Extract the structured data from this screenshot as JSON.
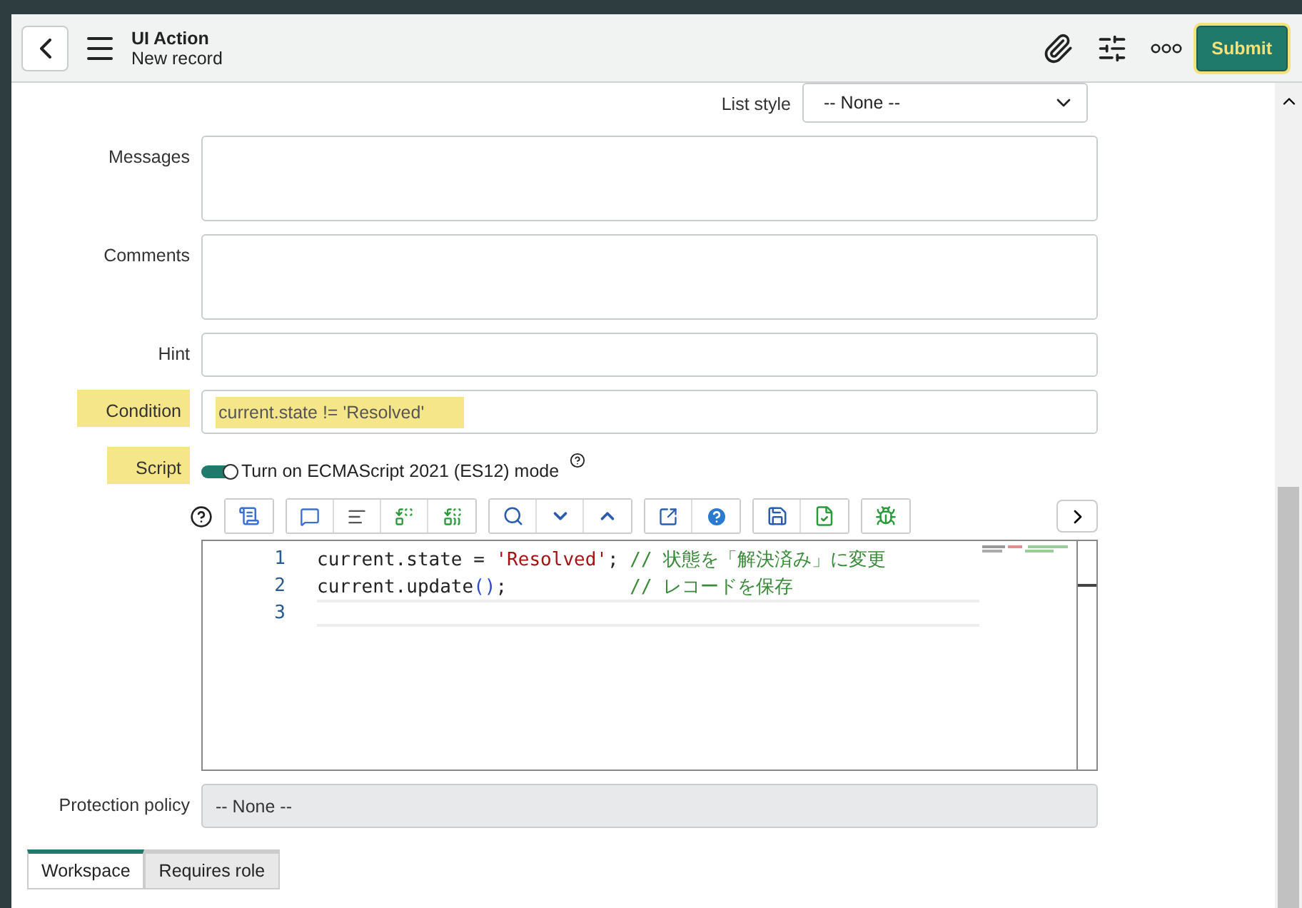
{
  "header": {
    "title": "UI Action",
    "subtitle": "New record",
    "submit": {
      "label": "Submit",
      "highlighted": true
    }
  },
  "list_style": {
    "label": "List style",
    "value": "-- None --"
  },
  "messages": {
    "label": "Messages"
  },
  "comments": {
    "label": "Comments"
  },
  "hint": {
    "label": "Hint"
  },
  "condition": {
    "label": "Condition",
    "value": "current.state != 'Resolved'",
    "highlighted": true
  },
  "script": {
    "label": "Script",
    "highlighted": true,
    "toggle": {
      "label": "Turn on ECMAScript 2021 (ES12) mode",
      "on": true
    },
    "lines": [
      {
        "number": "1",
        "tokens": [
          {
            "kind": "plain",
            "text": "current.state = "
          },
          {
            "kind": "string",
            "text": "'Resolved'"
          },
          {
            "kind": "plain",
            "text": "; "
          },
          {
            "kind": "comment",
            "text": "// 状態を「解決済み」に変更"
          }
        ]
      },
      {
        "number": "2",
        "tokens": [
          {
            "kind": "plain",
            "text": "current.update"
          },
          {
            "kind": "paren",
            "text": "()"
          },
          {
            "kind": "plain",
            "text": ";           "
          },
          {
            "kind": "comment",
            "text": "// レコードを保存"
          }
        ]
      },
      {
        "number": "3",
        "active": true
      }
    ]
  },
  "protection_policy": {
    "label": "Protection policy",
    "value": "-- None --"
  },
  "tabs": [
    {
      "label": "Workspace",
      "selected": true
    },
    {
      "label": "Requires role",
      "selected": false
    }
  ]
}
